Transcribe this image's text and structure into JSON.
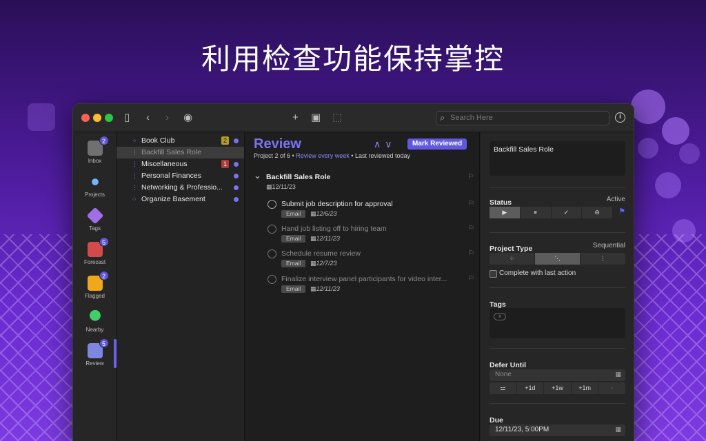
{
  "headline": "利用检查功能保持掌控",
  "toolbar": {
    "search_placeholder": "Search Here"
  },
  "rail": [
    {
      "label": "Inbox",
      "badge": "2"
    },
    {
      "label": "Projects",
      "badge": ""
    },
    {
      "label": "Tags",
      "badge": ""
    },
    {
      "label": "Forecast",
      "badge": "5"
    },
    {
      "label": "Flagged",
      "badge": "2"
    },
    {
      "label": "Nearby",
      "badge": ""
    },
    {
      "label": "Review",
      "badge": "5"
    }
  ],
  "projects": [
    {
      "name": "Book Club",
      "count": "2"
    },
    {
      "name": "Backfill Sales Role",
      "count": ""
    },
    {
      "name": "Miscellaneous",
      "count": "1"
    },
    {
      "name": "Personal Finances",
      "count": ""
    },
    {
      "name": "Networking & Professio...",
      "count": ""
    },
    {
      "name": "Organize Basement",
      "count": ""
    }
  ],
  "review": {
    "title": "Review",
    "mark_label": "Mark Reviewed",
    "progress": "Project 2 of 6",
    "sep": "•",
    "frequency": "Review every week",
    "last": "Last reviewed today",
    "group_title": "Backfill Sales Role",
    "group_date": "12/11/23",
    "tasks": [
      {
        "title": "Submit job description for approval",
        "tag": "Email",
        "date": "12/6/23"
      },
      {
        "title": "Hand job listing off to hiring team",
        "tag": "Email",
        "date": "12/11/23"
      },
      {
        "title": "Schedule resume review",
        "tag": "Email",
        "date": "12/7/23"
      },
      {
        "title": "Finalize interview panel participants for video inter...",
        "tag": "Email",
        "date": "12/11/23"
      }
    ]
  },
  "inspector": {
    "note": "Backfill Sales Role",
    "status_label": "Status",
    "status_value": "Active",
    "type_label": "Project Type",
    "type_value": "Sequential",
    "complete_label": "Complete with last action",
    "tags_label": "Tags",
    "defer_label": "Defer Until",
    "defer_value": "None",
    "defer_buttons": [
      "+1d",
      "+1w",
      "+1m"
    ],
    "due_label": "Due",
    "due_value": "12/11/23, 5:00PM"
  },
  "colors": {
    "accent": "#6158e0",
    "badge": "#5e55d6"
  }
}
